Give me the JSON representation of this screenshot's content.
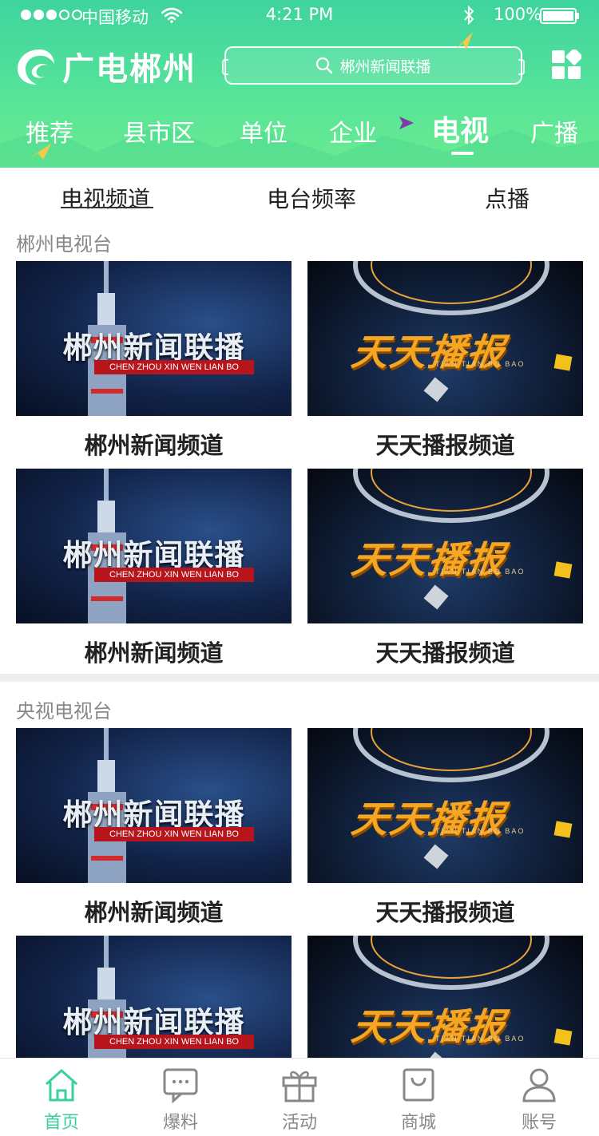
{
  "status_bar": {
    "carrier": "中国移动",
    "time": "4:21 PM",
    "battery": "100%"
  },
  "header": {
    "logo_text": "广电郴州",
    "search_placeholder": "郴州新闻联播",
    "accent_color": "#3fd49e"
  },
  "nav_tabs": [
    {
      "label": "推荐",
      "active": false
    },
    {
      "label": "县市区",
      "active": false
    },
    {
      "label": "单位",
      "active": false
    },
    {
      "label": "企业",
      "active": false
    },
    {
      "label": "电视",
      "active": true
    },
    {
      "label": "广播",
      "active": false
    }
  ],
  "sub_tabs": [
    {
      "label": "电视频道",
      "active": true
    },
    {
      "label": "电台频率",
      "active": false
    },
    {
      "label": "点播",
      "active": false
    }
  ],
  "sections": [
    {
      "label": "郴州电视台",
      "cards": [
        {
          "title": "郴州新闻频道",
          "thumb": "news"
        },
        {
          "title": "天天播报频道",
          "thumb": "daily"
        },
        {
          "title": "郴州新闻频道",
          "thumb": "news"
        },
        {
          "title": "天天播报频道",
          "thumb": "daily"
        }
      ]
    },
    {
      "label": "央视电视台",
      "cards": [
        {
          "title": "郴州新闻频道",
          "thumb": "news"
        },
        {
          "title": "天天播报频道",
          "thumb": "daily"
        },
        {
          "title": "",
          "thumb": "news"
        },
        {
          "title": "",
          "thumb": "daily"
        }
      ]
    }
  ],
  "thumb_text": {
    "news_title": "郴州新闻联播",
    "news_subtitle": "CHEN ZHOU XIN WEN LIAN BO",
    "daily_title": "天天播报",
    "daily_subtitle": "TIAN TIAN BO BAO"
  },
  "bottom_bar": [
    {
      "label": "首页",
      "icon": "home-icon",
      "active": true
    },
    {
      "label": "爆料",
      "icon": "chat-icon",
      "active": false
    },
    {
      "label": "活动",
      "icon": "gift-icon",
      "active": false
    },
    {
      "label": "商城",
      "icon": "bag-icon",
      "active": false
    },
    {
      "label": "账号",
      "icon": "user-icon",
      "active": false
    }
  ]
}
